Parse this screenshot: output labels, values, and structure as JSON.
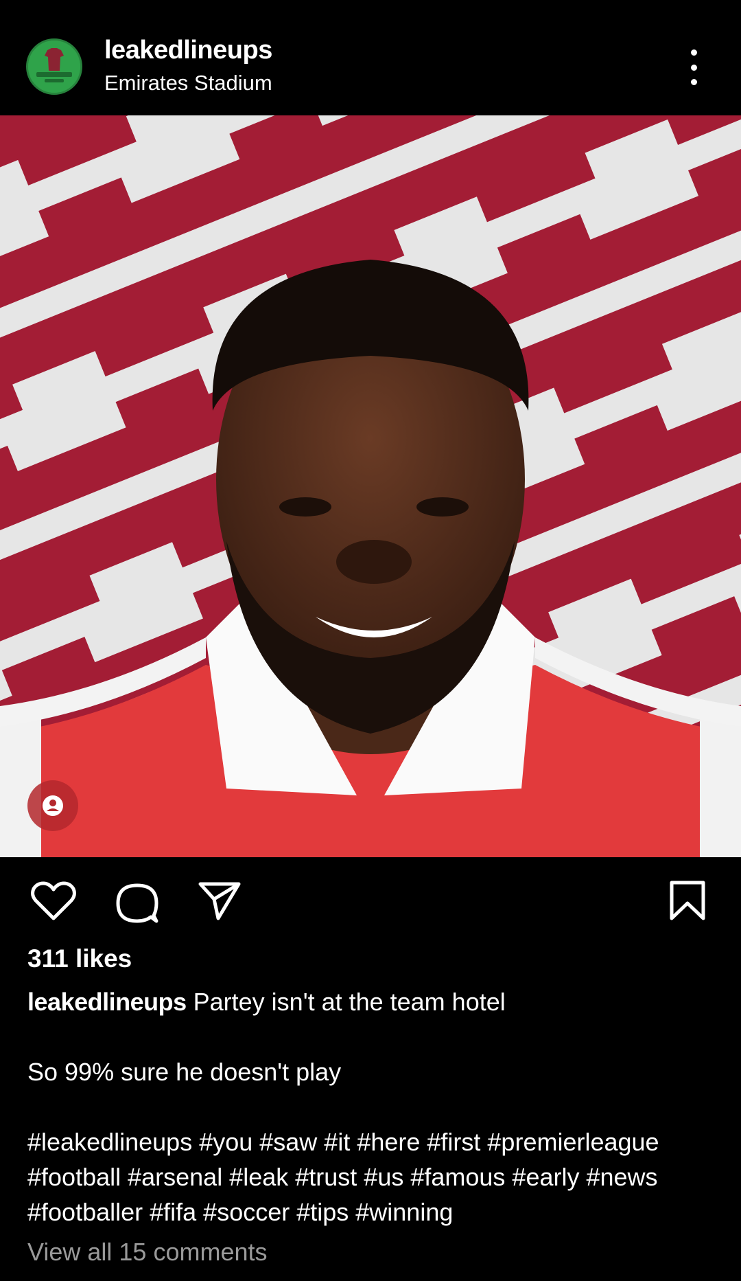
{
  "post": {
    "username": "leakedlineups",
    "location": "Emirates Stadium",
    "avatar_text": "@leakedlineups",
    "likes": "311 likes",
    "caption_user": "leakedlineups",
    "caption_lines": [
      "Partey isn't at the team hotel",
      "",
      "So 99% sure he doesn't play",
      "",
      "#leakedlineups #you #saw #it #here #first #premierleague",
      "#football #arsenal #leak #trust #us #famous #early #news",
      "#footballer #fifa #soccer #tips #winning"
    ],
    "view_comments": "View all 15 comments"
  },
  "icons": {
    "more": "more-options-icon",
    "tag": "user-tag-icon",
    "like": "heart-icon",
    "comment": "comment-icon",
    "share": "send-icon",
    "save": "bookmark-icon"
  },
  "colors": {
    "background": "#000000",
    "stripe_red": "#a31d35",
    "stripe_white": "#e6e6e6",
    "jersey_red": "#e23a3c",
    "avatar_green": "#2fa34a",
    "muted_text": "#9a9a9a"
  }
}
